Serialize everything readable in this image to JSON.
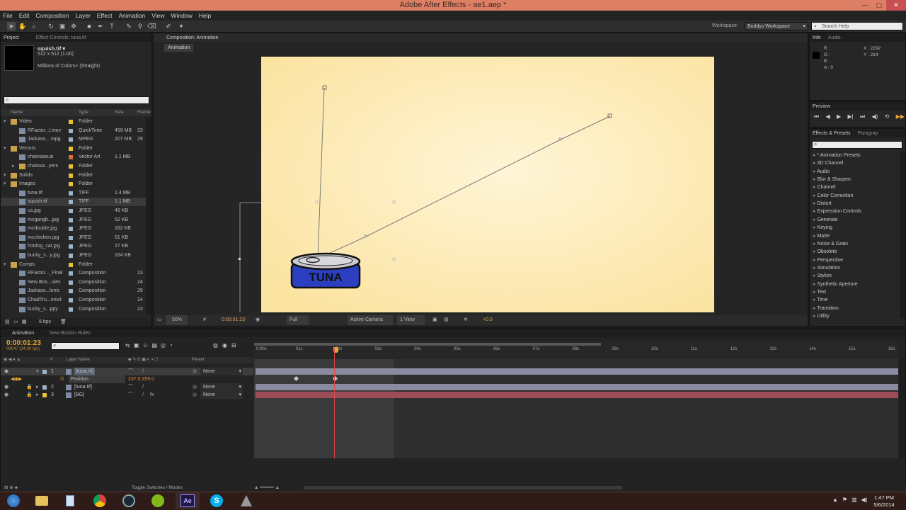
{
  "window": {
    "title": "Adobe After Effects - ae1.aep *"
  },
  "menu": [
    "File",
    "Edit",
    "Composition",
    "Layer",
    "Effect",
    "Animation",
    "View",
    "Window",
    "Help"
  ],
  "workspace": {
    "label": "Workspace:",
    "value": "Buddys Workspace"
  },
  "search_help": {
    "placeholder": "Search Help"
  },
  "project_panel": {
    "tabs": [
      "Project",
      "Effect Controls: tuna.tif"
    ],
    "preview_name": "squish.tif ▾",
    "preview_dims": "512 x 512 (1.00)",
    "preview_colors": "Millions of Colors+ (Straight)",
    "columns": [
      "Name",
      "Type",
      "Size",
      "Frame"
    ],
    "items": [
      {
        "name": "Video",
        "type": "Folder",
        "size": "",
        "frame": "",
        "indent": 0,
        "folder": true,
        "color": "#e7c232"
      },
      {
        "name": "RFactor...l.mov",
        "type": "QuickTime",
        "size": "459 MB",
        "frame": "23",
        "indent": 1,
        "color": "#9fb3c8"
      },
      {
        "name": "Jackass....mpg",
        "type": "MPEG",
        "size": "207 MB",
        "frame": "29",
        "indent": 1,
        "color": "#9fb3c8"
      },
      {
        "name": "Vectors",
        "type": "Folder",
        "size": "",
        "frame": "",
        "indent": 0,
        "folder": true,
        "color": "#e7c232"
      },
      {
        "name": "chainsaw.ai",
        "type": "Vector Art",
        "size": "1.1 MB",
        "frame": "",
        "indent": 1,
        "color": "#d96d3a"
      },
      {
        "name": "chainsa...yers",
        "type": "Folder",
        "size": "",
        "frame": "",
        "indent": 1,
        "folder": true,
        "color": "#e7c232"
      },
      {
        "name": "Solids",
        "type": "Folder",
        "size": "",
        "frame": "",
        "indent": 0,
        "folder": true,
        "color": "#e7c232"
      },
      {
        "name": "Images",
        "type": "Folder",
        "size": "",
        "frame": "",
        "indent": 0,
        "folder": true,
        "color": "#e7c232"
      },
      {
        "name": "tuna.tif",
        "type": "TIFF",
        "size": "1.4 MB",
        "frame": "",
        "indent": 1,
        "color": "#9fb3c8"
      },
      {
        "name": "squish.tif",
        "type": "TIFF",
        "size": "1.1 MB",
        "frame": "",
        "indent": 1,
        "color": "#9fb3c8",
        "selected": true
      },
      {
        "name": "us.jpg",
        "type": "JPEG",
        "size": "49 KB",
        "frame": "",
        "indent": 1,
        "color": "#9fb3c8"
      },
      {
        "name": "mcgangb...jpg",
        "type": "JPEG",
        "size": "52 KB",
        "frame": "",
        "indent": 1,
        "color": "#9fb3c8"
      },
      {
        "name": "mcdouble.jpg",
        "type": "JPEG",
        "size": "162 KB",
        "frame": "",
        "indent": 1,
        "color": "#9fb3c8"
      },
      {
        "name": "mcchicken.jpg",
        "type": "JPEG",
        "size": "51 KB",
        "frame": "",
        "indent": 1,
        "color": "#9fb3c8"
      },
      {
        "name": "hotdog_cat.jpg",
        "type": "JPEG",
        "size": "27 KB",
        "frame": "",
        "indent": 1,
        "color": "#9fb3c8"
      },
      {
        "name": "bucky_s...y.jpg",
        "type": "JPEG",
        "size": "164 KB",
        "frame": "",
        "indent": 1,
        "color": "#9fb3c8"
      },
      {
        "name": "Comps",
        "type": "Folder",
        "size": "",
        "frame": "",
        "indent": 0,
        "folder": true,
        "color": "#e7c232"
      },
      {
        "name": "RFactor..._Final",
        "type": "Composition",
        "size": "",
        "frame": "23",
        "indent": 1,
        "color": "#9fb3c8"
      },
      {
        "name": "New Bos...ules",
        "type": "Composition",
        "size": "",
        "frame": "24",
        "indent": 1,
        "color": "#9fb3c8"
      },
      {
        "name": "Jackass...lonic",
        "type": "Composition",
        "size": "",
        "frame": "29",
        "indent": 1,
        "color": "#9fb3c8"
      },
      {
        "name": "ChadTru...ons4",
        "type": "Composition",
        "size": "",
        "frame": "24",
        "indent": 1,
        "color": "#9fb3c8"
      },
      {
        "name": "bucky_s...ppy",
        "type": "Composition",
        "size": "",
        "frame": "23",
        "indent": 1,
        "color": "#9fb3c8"
      }
    ],
    "bpc": "8 bpc"
  },
  "composition_panel": {
    "tab": "Composition: Animation",
    "subtab": "Animation",
    "zoom": "50%",
    "timecode": "0:00:01:23",
    "resolution": "Full",
    "camera": "Active Camera",
    "views": "1 View",
    "exposure": "+0.0",
    "canvas_text": "TUNA"
  },
  "info_panel": {
    "tabs": [
      "Info",
      "Audio"
    ],
    "r": "R :",
    "g": "G :",
    "b": "B :",
    "a": "A : 0",
    "x": "X : 2292",
    "y": "Y : 214"
  },
  "preview_panel": {
    "tab": "Preview"
  },
  "effects_panel": {
    "tabs": [
      "Effects & Presets",
      "Paragrap"
    ],
    "items": [
      "* Animation Presets",
      "3D Channel",
      "Audio",
      "Blur & Sharpen",
      "Channel",
      "Color Correction",
      "Distort",
      "Expression Controls",
      "Generate",
      "Keying",
      "Matte",
      "Noise & Grain",
      "Obsolete",
      "Perspective",
      "Simulation",
      "Stylize",
      "Synthetic Aperture",
      "Text",
      "Time",
      "Transition",
      "Utility"
    ]
  },
  "timeline": {
    "tabs": [
      "Animation",
      "New Boston Rules"
    ],
    "timecode": "0:00:01:23",
    "frames": "00047 (24.00 fps)",
    "col_layer_name": "Layer Name",
    "col_parent": "Parent",
    "layers": [
      {
        "num": "1",
        "name": "[tuna.tif]",
        "parent": "None",
        "selected": true,
        "label": "#9fb3c8"
      },
      {
        "num": "2",
        "name": "[tuna.tif]",
        "parent": "None",
        "label": "#9fb3c8"
      },
      {
        "num": "3",
        "name": "[BG]",
        "parent": "None",
        "label": "#e7c232"
      }
    ],
    "position_label": "Position",
    "position_value": "237.0,359.0",
    "ruler": [
      "0:00s",
      "01s",
      "02s",
      "03s",
      "04s",
      "05s",
      "06s",
      "07s",
      "08s",
      "09s",
      "10s",
      "11s",
      "12s",
      "13s",
      "14s",
      "15s",
      "16s"
    ],
    "toggle_label": "Toggle Switches / Modes"
  },
  "taskbar": {
    "time": "1:47 PM",
    "date": "5/6/2014"
  },
  "colors": {
    "titlebar": "#dc7f64",
    "accent": "#e8a33a",
    "canvas": "#fbe7a2",
    "tuna_blue": "#2b3fc0"
  }
}
